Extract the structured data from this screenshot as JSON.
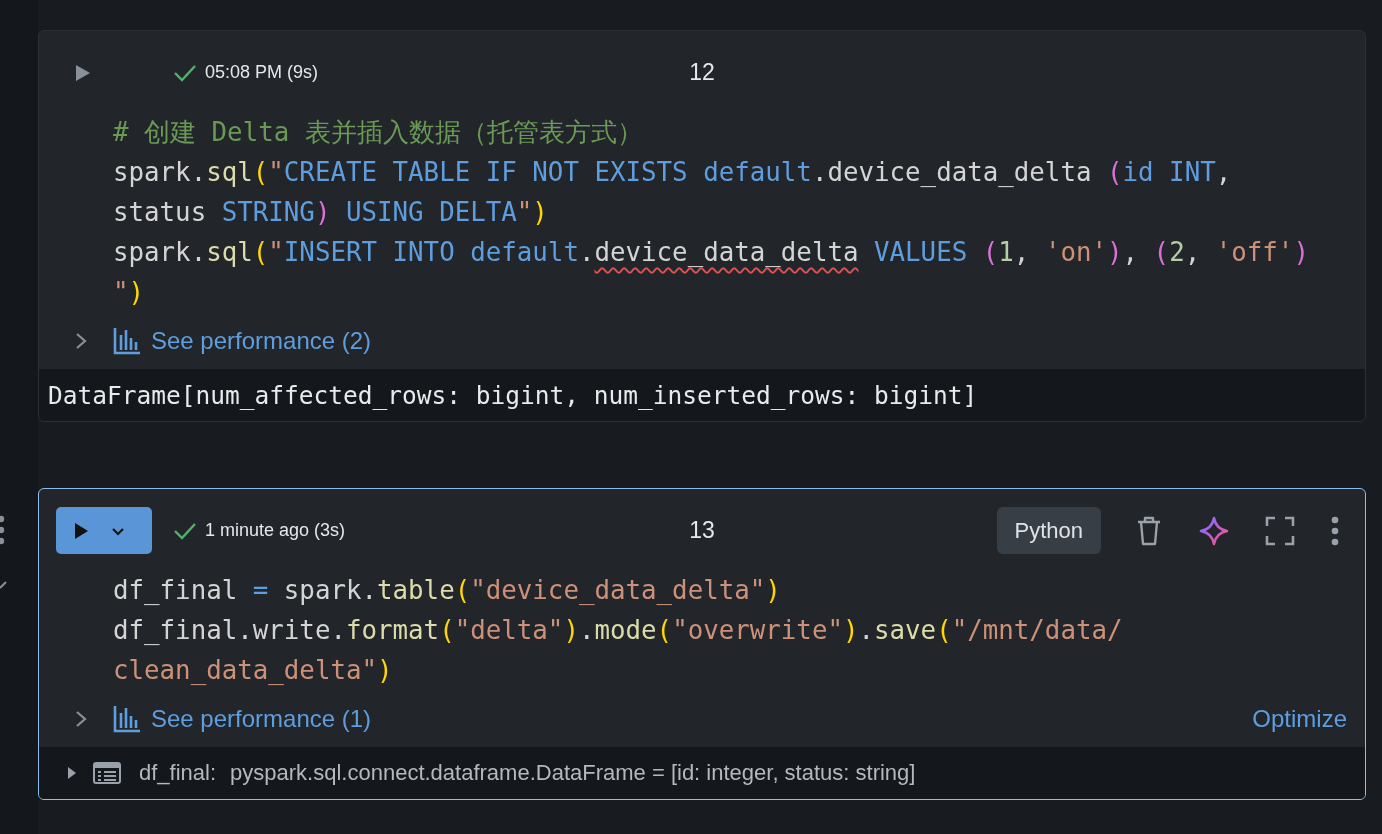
{
  "cells": [
    {
      "selected": false,
      "status": {
        "succeeded": true,
        "text": "05:08 PM (9s)"
      },
      "number": "12",
      "code_lines": [
        [
          {
            "kind": "comment",
            "text": "# 创建 Delta 表并插入数据（托管表方式）"
          }
        ],
        [
          {
            "kind": "plain",
            "text": "spark."
          },
          {
            "kind": "func",
            "text": "sql"
          },
          {
            "kind": "paren",
            "text": "("
          },
          {
            "kind": "string",
            "text": "\""
          },
          {
            "kind": "keyword",
            "text": "CREATE TABLE IF NOT EXISTS default"
          },
          {
            "kind": "plain",
            "text": ".device_data_delta "
          },
          {
            "kind": "paren2",
            "text": "("
          },
          {
            "kind": "keyword",
            "text": "id INT"
          },
          {
            "kind": "plain",
            "text": ","
          }
        ],
        [
          {
            "kind": "plain",
            "text": "status "
          },
          {
            "kind": "keyword",
            "text": "STRING"
          },
          {
            "kind": "paren2",
            "text": ")"
          },
          {
            "kind": "keyword",
            "text": " USING DELTA"
          },
          {
            "kind": "string",
            "text": "\""
          },
          {
            "kind": "paren",
            "text": ")"
          }
        ],
        [
          {
            "kind": "plain",
            "text": "spark."
          },
          {
            "kind": "func",
            "text": "sql"
          },
          {
            "kind": "paren",
            "text": "("
          },
          {
            "kind": "string",
            "text": "\""
          },
          {
            "kind": "keyword",
            "text": "INSERT INTO default"
          },
          {
            "kind": "plain",
            "text": "."
          },
          {
            "kind": "plain",
            "text": "device_data_delta",
            "error": true
          },
          {
            "kind": "keyword",
            "text": " VALUES "
          },
          {
            "kind": "paren2",
            "text": "("
          },
          {
            "kind": "number",
            "text": "1"
          },
          {
            "kind": "plain",
            "text": ", "
          },
          {
            "kind": "string",
            "text": "'on'"
          },
          {
            "kind": "paren2",
            "text": ")"
          },
          {
            "kind": "plain",
            "text": ", "
          },
          {
            "kind": "paren2",
            "text": "("
          },
          {
            "kind": "number",
            "text": "2"
          },
          {
            "kind": "plain",
            "text": ", "
          },
          {
            "kind": "string",
            "text": "'off'"
          },
          {
            "kind": "paren2",
            "text": ")"
          }
        ],
        [
          {
            "kind": "string",
            "text": "\""
          },
          {
            "kind": "paren",
            "text": ")"
          }
        ]
      ],
      "performance": {
        "label": "See performance (2)",
        "expanded": false
      },
      "output": {
        "kind": "text",
        "text": "DataFrame[num_affected_rows: bigint, num_inserted_rows: bigint]"
      }
    },
    {
      "selected": true,
      "status": {
        "succeeded": true,
        "text": "1 minute ago (3s)"
      },
      "number": "13",
      "language": "Python",
      "code_lines": [
        [
          {
            "kind": "plain",
            "text": "df_final "
          },
          {
            "kind": "operator",
            "text": "="
          },
          {
            "kind": "plain",
            "text": " spark."
          },
          {
            "kind": "func",
            "text": "table"
          },
          {
            "kind": "paren",
            "text": "("
          },
          {
            "kind": "string",
            "text": "\"device_data_delta\""
          },
          {
            "kind": "paren",
            "text": ")"
          }
        ],
        [
          {
            "kind": "plain",
            "text": "df_final.write."
          },
          {
            "kind": "func",
            "text": "format"
          },
          {
            "kind": "paren",
            "text": "("
          },
          {
            "kind": "string",
            "text": "\"delta\""
          },
          {
            "kind": "paren",
            "text": ")"
          },
          {
            "kind": "plain",
            "text": "."
          },
          {
            "kind": "func",
            "text": "mode"
          },
          {
            "kind": "paren",
            "text": "("
          },
          {
            "kind": "string",
            "text": "\"overwrite\""
          },
          {
            "kind": "paren",
            "text": ")"
          },
          {
            "kind": "plain",
            "text": "."
          },
          {
            "kind": "func",
            "text": "save"
          },
          {
            "kind": "paren",
            "text": "("
          },
          {
            "kind": "string",
            "text": "\"/mnt/data/"
          }
        ],
        [
          {
            "kind": "string",
            "text": "clean_data_delta\""
          },
          {
            "kind": "paren",
            "text": ")"
          }
        ]
      ],
      "performance": {
        "label": "See performance (1)",
        "expanded": false
      },
      "optimize_link": "Optimize",
      "output": {
        "kind": "variable",
        "expanded": false,
        "name": "df_final:",
        "value": "pyspark.sql.connect.dataframe.DataFrame = [id: integer, status: string]"
      }
    }
  ]
}
